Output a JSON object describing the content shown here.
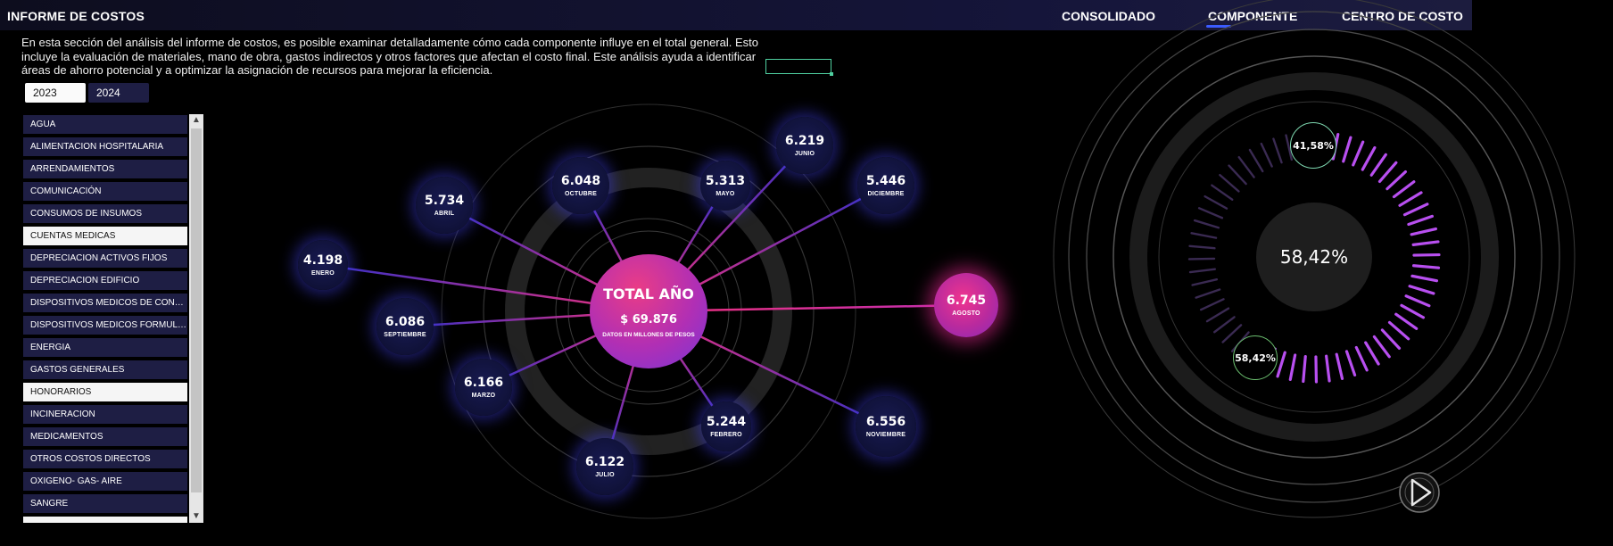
{
  "header": {
    "title": "INFORME DE COSTOS",
    "tabs": [
      {
        "label": "CONSOLIDADO",
        "active": false
      },
      {
        "label": "COMPONENTE",
        "active": true
      },
      {
        "label": "CENTRO DE COSTO",
        "active": false
      }
    ],
    "accent_color": "#3b5bff"
  },
  "description": "En esta sección del análisis del informe de costos, es posible examinar detalladamente cómo cada componente influye en el total general. Esto incluye la evaluación de materiales, mano de obra, gastos indirectos y otros factores que afectan el costo final. Este análisis ayuda a identificar áreas de ahorro potencial y a optimizar la asignación de recursos para mejorar la eficiencia.",
  "years": [
    {
      "label": "2023",
      "selected": true
    },
    {
      "label": "2024",
      "selected": false
    }
  ],
  "components": [
    {
      "label": "AGUA",
      "selected": false
    },
    {
      "label": "ALIMENTACION HOSPITALARIA",
      "selected": false
    },
    {
      "label": "ARRENDAMIENTOS",
      "selected": false
    },
    {
      "label": "COMUNICACIÓN",
      "selected": false
    },
    {
      "label": "CONSUMOS DE INSUMOS",
      "selected": false
    },
    {
      "label": "CUENTAS MEDICAS",
      "selected": true
    },
    {
      "label": "DEPRECIACION ACTIVOS FIJOS",
      "selected": false
    },
    {
      "label": "DEPRECIACION EDIFICIO",
      "selected": false
    },
    {
      "label": "DISPOSITIVOS MEDICOS DE CONSU...",
      "selected": false
    },
    {
      "label": "DISPOSITIVOS MEDICOS FORMULA...",
      "selected": false
    },
    {
      "label": "ENERGIA",
      "selected": false
    },
    {
      "label": "GASTOS GENERALES",
      "selected": false
    },
    {
      "label": "HONORARIOS",
      "selected": true
    },
    {
      "label": "INCINERACION",
      "selected": false
    },
    {
      "label": "MEDICAMENTOS",
      "selected": false
    },
    {
      "label": "OTROS COSTOS DIRECTOS",
      "selected": false
    },
    {
      "label": "OXIGENO-   GAS-    AIRE",
      "selected": false
    },
    {
      "label": "SANGRE",
      "selected": false
    }
  ],
  "total": {
    "title": "TOTAL AÑO",
    "value": "$ 69.876",
    "note": "DATOS EN MILLONES DE PESOS"
  },
  "months": [
    {
      "value": "4.198",
      "month": "ENERO",
      "highlight": false
    },
    {
      "value": "5.244",
      "month": "FEBRERO",
      "highlight": false
    },
    {
      "value": "6.166",
      "month": "MARZO",
      "highlight": false
    },
    {
      "value": "5.734",
      "month": "ABRIL",
      "highlight": false
    },
    {
      "value": "5.313",
      "month": "MAYO",
      "highlight": false
    },
    {
      "value": "6.219",
      "month": "JUNIO",
      "highlight": false
    },
    {
      "value": "6.122",
      "month": "JULIO",
      "highlight": false
    },
    {
      "value": "6.745",
      "month": "AGOSTO",
      "highlight": true
    },
    {
      "value": "6.086",
      "month": "SEPTIEMBRE",
      "highlight": false
    },
    {
      "value": "6.048",
      "month": "OCTUBRE",
      "highlight": false
    },
    {
      "value": "6.556",
      "month": "NOVIEMBRE",
      "highlight": false
    },
    {
      "value": "5.446",
      "month": "DICIEMBRE",
      "highlight": false
    }
  ],
  "gauge": {
    "center_label": "58,42%",
    "top_label": "41,58%",
    "bottom_label": "58,42%",
    "share": 0.5842,
    "tick_color": "#b84ff0"
  },
  "icons": {
    "play": "play-icon"
  }
}
